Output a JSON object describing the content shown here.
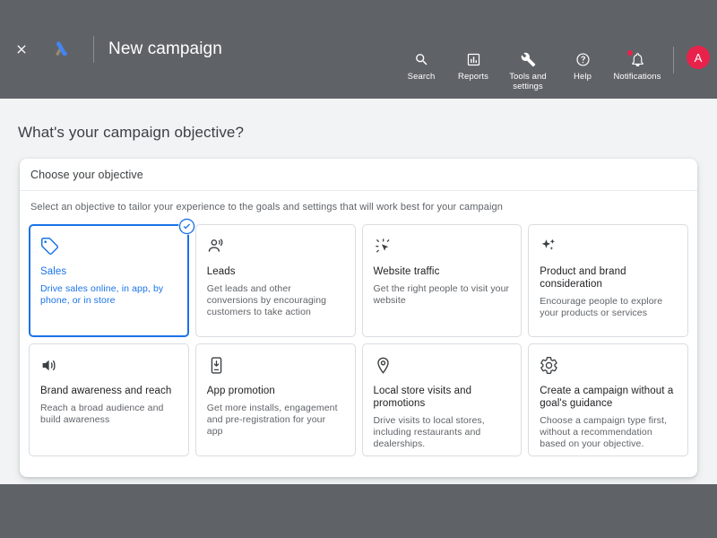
{
  "appbar": {
    "close_icon": "close-icon",
    "logo_icon": "google-ads-logo-icon",
    "title": "New campaign",
    "tools": [
      {
        "icon": "search-icon",
        "label": "Search"
      },
      {
        "icon": "reports-bar-chart-icon",
        "label": "Reports"
      },
      {
        "icon": "wrench-tools-icon",
        "label": "Tools and settings"
      },
      {
        "icon": "help-question-icon",
        "label": "Help"
      },
      {
        "icon": "notifications-bell-icon",
        "label": "Notifications"
      }
    ],
    "avatar_initial": "A"
  },
  "page": {
    "title": "What's your campaign objective?"
  },
  "panel": {
    "header_title": "Choose your objective",
    "subtitle": "Select an objective to tailor your experience to the goals and settings that will work best for your campaign",
    "objectives": [
      {
        "icon": "tag-icon",
        "title": "Sales",
        "description": "Drive sales online, in app, by phone, or in store",
        "selected": true,
        "check_icon": "check-circle-icon"
      },
      {
        "icon": "leads-person-icon",
        "title": "Leads",
        "description": "Get leads and other conversions by encouraging customers to take action",
        "selected": false
      },
      {
        "icon": "cursor-click-icon",
        "title": "Website traffic",
        "description": "Get the right people to visit your website",
        "selected": false
      },
      {
        "icon": "sparkles-icon",
        "title": "Product and brand consideration",
        "description": "Encourage people to explore your products or services",
        "selected": false
      },
      {
        "icon": "speaker-volume-icon",
        "title": "Brand awareness and reach",
        "description": "Reach a broad audience and build awareness",
        "selected": false
      },
      {
        "icon": "phone-download-icon",
        "title": "App promotion",
        "description": "Get more installs, engagement and pre-registration for your app",
        "selected": false
      },
      {
        "icon": "location-pin-icon",
        "title": "Local store visits and promotions",
        "description": "Drive visits to local stores, including restaurants and dealerships.",
        "selected": false
      },
      {
        "icon": "gear-settings-icon",
        "title": "Create a campaign without a goal's guidance",
        "description": "Choose a campaign type first, without a recommendation based on your objective.",
        "selected": false
      }
    ]
  },
  "colors": {
    "appbar_bg": "#5f6368",
    "content_bg": "#f1f3f4",
    "accent_blue": "#1a73e8",
    "avatar_bg": "#e8224a",
    "notification_dot": "#e8224a"
  }
}
